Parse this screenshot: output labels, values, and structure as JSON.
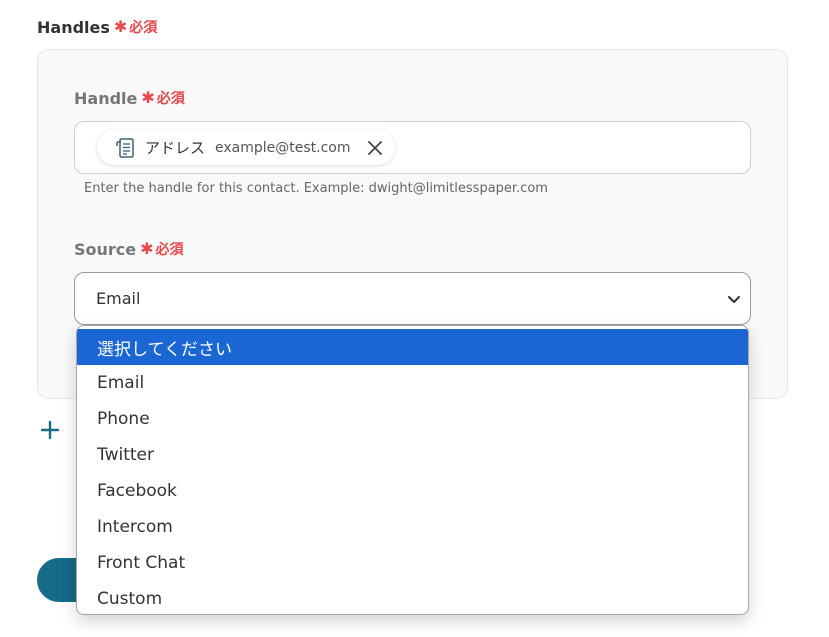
{
  "handles_section": {
    "label": "Handles",
    "required_mark": "✱",
    "required_text": "必須"
  },
  "handle_field": {
    "label": "Handle",
    "required_mark": "✱",
    "required_text": "必須",
    "chip": {
      "icon": "form-field-icon",
      "label": "アドレス",
      "value": "example@test.com",
      "remove_icon": "close-icon"
    },
    "hint": "Enter the handle for this contact. Example: dwight@limitlesspaper.com"
  },
  "source_field": {
    "label": "Source",
    "required_mark": "✱",
    "required_text": "必須",
    "selected_value": "Email",
    "chevron_icon": "chevron-down-icon",
    "options": [
      "選択してください",
      "Email",
      "Phone",
      "Twitter",
      "Facebook",
      "Intercom",
      "Front Chat",
      "Custom"
    ],
    "highlighted_option": "選択してください"
  },
  "add_handle": {
    "icon": "plus-icon",
    "label_fragment": "+"
  },
  "colors": {
    "required": "#e5484d",
    "highlight": "#1a66d2",
    "accent": "#166a8a",
    "card_bg": "#f9f9f9"
  }
}
